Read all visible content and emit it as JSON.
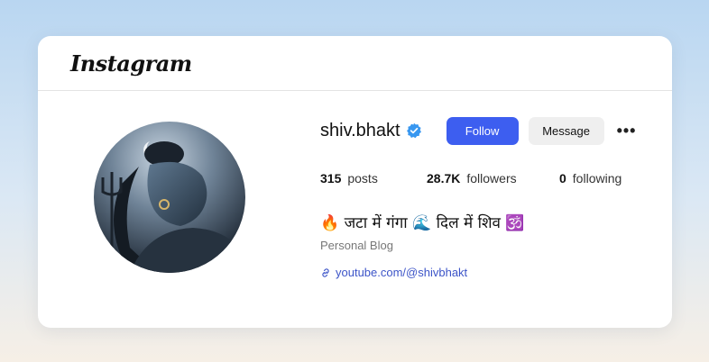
{
  "app": {
    "brand": "Instagram"
  },
  "profile": {
    "username": "shiv.bhakt",
    "verified": true,
    "follow_label": "Follow",
    "message_label": "Message",
    "more_label": "•••",
    "stats": {
      "posts_count": "315",
      "posts_label": "posts",
      "followers_count": "28.7K",
      "followers_label": "followers",
      "following_count": "0",
      "following_label": "following"
    },
    "bio": "🔥 जटा में गंगा 🌊 दिल में शिव 🕉️",
    "category": "Personal Blog",
    "link": "youtube.com/@shivbhakt"
  },
  "icons": {
    "verified": "verified-badge-icon",
    "link": "link-icon",
    "more": "more-options-icon"
  },
  "colors": {
    "accent": "#3d5ef0",
    "verified": "#3897f0",
    "link": "#3d55c8"
  }
}
